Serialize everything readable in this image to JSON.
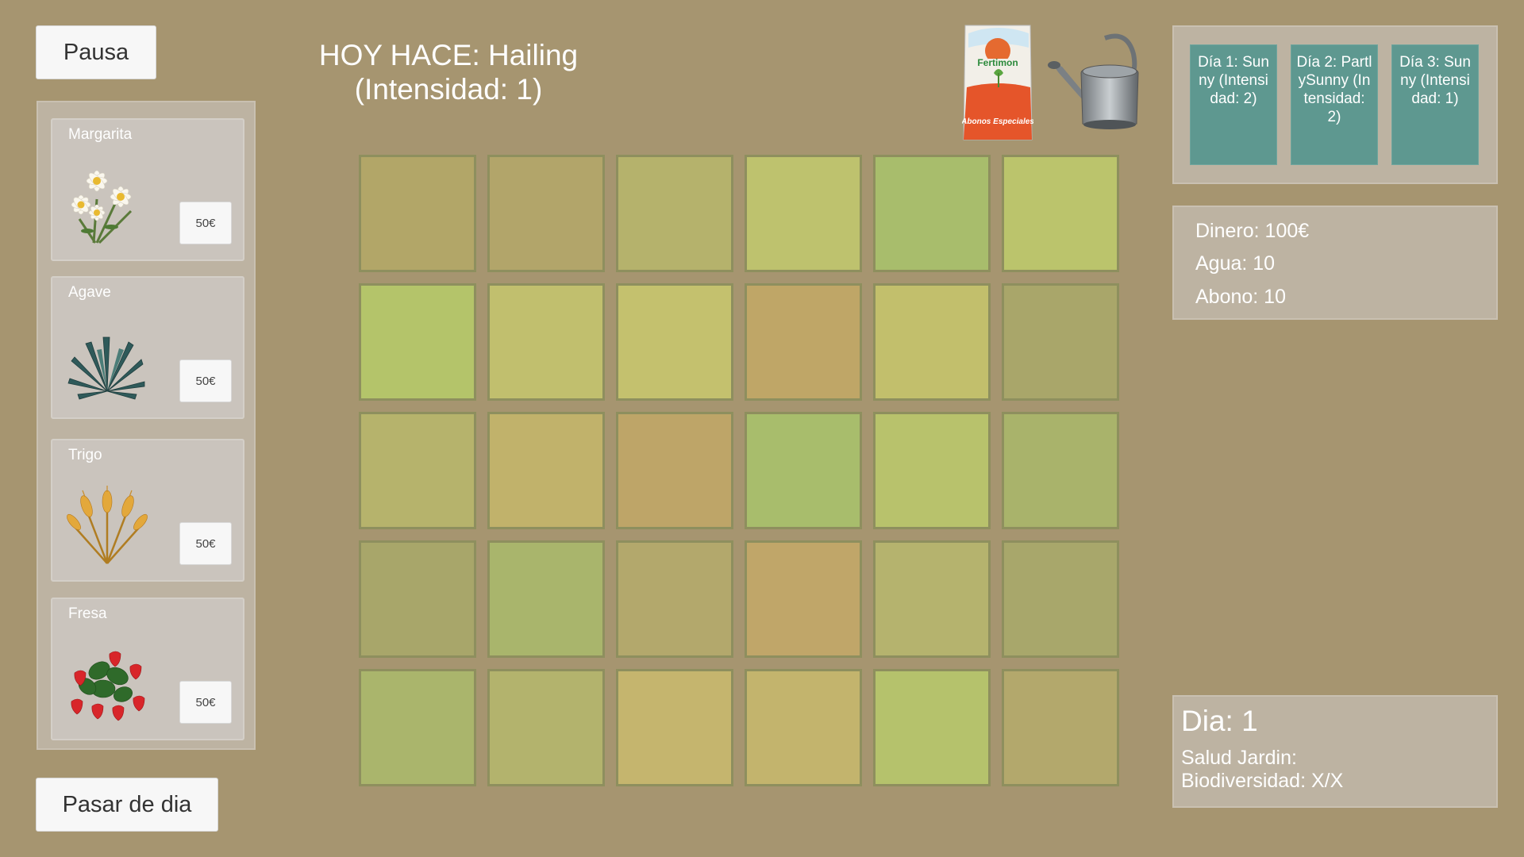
{
  "buttons": {
    "pause": "Pausa",
    "next_day": "Pasar de dia"
  },
  "weather": {
    "line1": "HOY HACE: Hailing",
    "line2": "(Intensidad: 1)"
  },
  "shop": {
    "items": [
      {
        "name": "Margarita",
        "price": "50€",
        "icon": "daisy-icon"
      },
      {
        "name": "Agave",
        "price": "50€",
        "icon": "agave-icon"
      },
      {
        "name": "Trigo",
        "price": "50€",
        "icon": "wheat-icon"
      },
      {
        "name": "Fresa",
        "price": "50€",
        "icon": "strawberry-icon"
      }
    ]
  },
  "tools": {
    "fertilizer": {
      "icon": "fertilizer-bag-icon",
      "brand": "Fertimon",
      "subtitle": "Abonos Especiales"
    },
    "watering": {
      "icon": "watering-can-icon"
    }
  },
  "forecast": [
    {
      "text": "Día 1: Sunny (Intensidad: 2)"
    },
    {
      "text": "Día 2: PartlySunny (Intensidad: 2)"
    },
    {
      "text": "Día 3: Sunny (Intensidad: 1)"
    }
  ],
  "resources": {
    "money": "Dinero: 100€",
    "water": "Agua: 10",
    "fertilizer": "Abono: 10"
  },
  "status": {
    "day": "Dia: 1",
    "health": "Salud Jardin:",
    "biodiversity": "Biodiversidad: X/X"
  },
  "garden": {
    "rows": 5,
    "cols": 6,
    "cells": [
      "#b2a668",
      "#b2a56a",
      "#b5b26c",
      "#bec26e",
      "#a8bd6c",
      "#bbc46c",
      "#b4c46a",
      "#c1bf6e",
      "#c4c16e",
      "#bfa667",
      "#c2bf6c",
      "#a9a66a",
      "#b6b36c",
      "#c1b26b",
      "#bea568",
      "#a8bd6c",
      "#b8c26c",
      "#a9b36b",
      "#a8a66a",
      "#a9b56c",
      "#b3a86c",
      "#c0a669",
      "#b5b36e",
      "#a8a76b",
      "#aab56c",
      "#b3b36d",
      "#c5b56e",
      "#c3b46d",
      "#b5c26c",
      "#b3a86c"
    ]
  }
}
